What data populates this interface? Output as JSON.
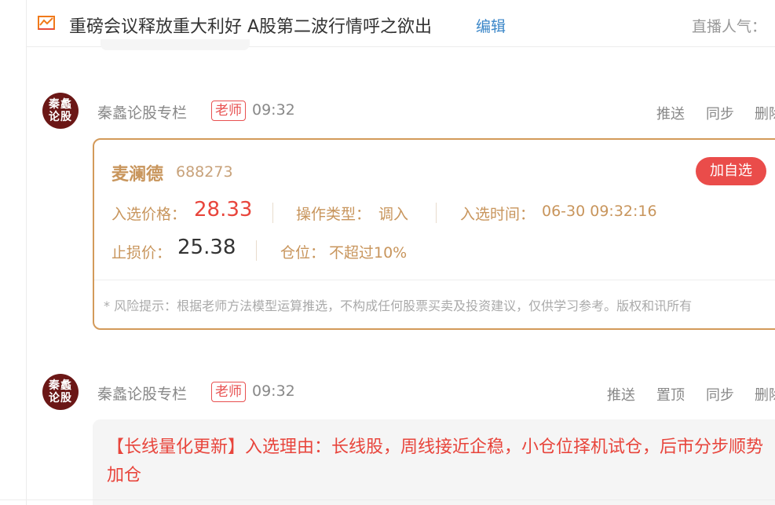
{
  "header": {
    "title": "重磅会议释放重大利好 A股第二波行情呼之欲出",
    "edit_label": "编辑",
    "popularity_label": "直播人气："
  },
  "posts": [
    {
      "avatar_text": [
        "秦蠡",
        "论股"
      ],
      "author": "秦蠡论股专栏",
      "badge": "老师",
      "time": "09:32",
      "actions": [
        "推送",
        "同步",
        "删除"
      ],
      "card": {
        "stock_name": "麦澜德",
        "stock_code": "688273",
        "add_button": "加自选",
        "entry_price_label": "入选价格：",
        "entry_price": "28.33",
        "op_type_label": "操作类型：",
        "op_type": "调入",
        "entry_time_label": "入选时间：",
        "entry_time": "06-30 09:32:16",
        "stop_loss_label": "止损价：",
        "stop_loss": "25.38",
        "position_label": "仓位：",
        "position": "不超过10%",
        "risk_notice": "* 风险提示：根据老师方法模型运算推选，不构成任何股票买卖及投资建议，仅供学习参考。版权和讯所有"
      }
    },
    {
      "avatar_text": [
        "秦蠡",
        "论股"
      ],
      "author": "秦蠡论股专栏",
      "badge": "老师",
      "time": "09:32",
      "actions": [
        "推送",
        "置顶",
        "同步",
        "删除"
      ],
      "message": "【长线量化更新】入选理由：长线股，周线接近企稳，小仓位择机试仓，后市分步顺势加仓"
    }
  ],
  "colors": {
    "accent_red": "#ea4c4a",
    "card_border": "#d39a5a",
    "gold_text": "#c8955c",
    "link_blue": "#3a86c8",
    "avatar_bg": "#6b1716"
  }
}
